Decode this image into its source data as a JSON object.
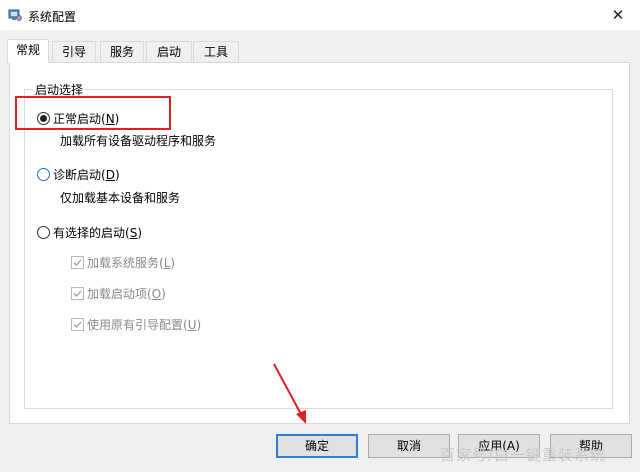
{
  "window": {
    "title": "系统配置",
    "close_glyph": "✕"
  },
  "tabs": [
    {
      "label": "常规",
      "active": true
    },
    {
      "label": "引导",
      "active": false
    },
    {
      "label": "服务",
      "active": false
    },
    {
      "label": "启动",
      "active": false
    },
    {
      "label": "工具",
      "active": false
    }
  ],
  "startup_group": {
    "title": "启动选择",
    "options": [
      {
        "label": "正常启动(",
        "key": "N",
        "suffix": ")",
        "checked": true,
        "description": "加载所有设备驱动程序和服务"
      },
      {
        "label": "诊断启动(",
        "key": "D",
        "suffix": ")",
        "checked": false,
        "description": "仅加载基本设备和服务"
      },
      {
        "label": "有选择的启动(",
        "key": "S",
        "suffix": ")",
        "checked": false
      }
    ],
    "sub_options": [
      {
        "label": "加载系统服务(",
        "key": "L",
        "suffix": ")",
        "checked": true,
        "enabled": false
      },
      {
        "label": "加载启动项(",
        "key": "O",
        "suffix": ")",
        "checked": true,
        "enabled": false
      },
      {
        "label": "使用原有引导配置(",
        "key": "U",
        "suffix": ")",
        "checked": true,
        "enabled": false
      }
    ]
  },
  "buttons": {
    "ok": "确定",
    "cancel": "取消",
    "apply": "应用(A)",
    "help": "帮助"
  },
  "watermark": "百家号/白一键重装系统",
  "annotation_color": "#e02020",
  "accent_color": "#2a7fd6"
}
